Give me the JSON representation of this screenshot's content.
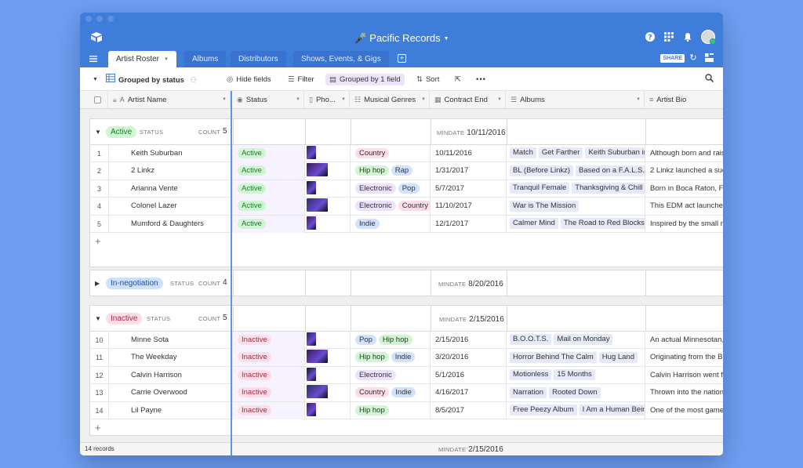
{
  "base": {
    "title": "Pacific Records"
  },
  "tabs": [
    {
      "label": "Artist Roster",
      "active": true
    },
    {
      "label": "Albums",
      "active": false
    },
    {
      "label": "Distributors",
      "active": false
    },
    {
      "label": "Shows, Events, & Gigs",
      "active": false
    }
  ],
  "tabbar": {
    "share_label": "SHARE"
  },
  "viewbar": {
    "view_name": "Grouped by status",
    "hide_fields": "Hide fields",
    "filter": "Filter",
    "grouped": "Grouped by 1 field",
    "sort": "Sort"
  },
  "columns": {
    "artist_name": "Artist Name",
    "status": "Status",
    "photo": "Pho...",
    "genres": "Musical Genres",
    "contract_end": "Contract End",
    "albums": "Albums",
    "bio": "Artist Bio"
  },
  "group_labels": {
    "status": "STATUS",
    "count": "COUNT",
    "mindate": "MINDATE"
  },
  "colors": {
    "active_bg": "#cff5d1",
    "active_text": "#1e7a2d",
    "negotiation_bg": "#cfe0fc",
    "negotiation_text": "#1d4e9c",
    "inactive_bg": "#fddde6",
    "inactive_text": "#a8294e",
    "country": "#fddde6",
    "hiphop": "#cff5d1",
    "rap": "#d1e2ff",
    "electronic": "#ede2fe",
    "pop": "#d1e2ff",
    "indie": "#d1e2ff"
  },
  "groups": [
    {
      "name": "Active",
      "count": "5",
      "mindate": "10/11/2016",
      "collapsed": false,
      "rows": [
        {
          "num": "1",
          "name": "Keith Suburban",
          "status": "Active",
          "genres": [
            "Country"
          ],
          "contract_end": "10/11/2016",
          "albums": [
            "Match",
            "Get Farther",
            "Keith Suburban in"
          ],
          "bio": "Although born and raised"
        },
        {
          "num": "2",
          "name": "2 Linkz",
          "status": "Active",
          "genres": [
            "Hip hop",
            "Rap"
          ],
          "contract_end": "1/31/2017",
          "albums": [
            "BL (Before Linkz)",
            "Based on a F.A.L.S.E"
          ],
          "bio": "2 Linkz launched a succ"
        },
        {
          "num": "3",
          "name": "Arianna Vente",
          "status": "Active",
          "genres": [
            "Electronic",
            "Pop"
          ],
          "contract_end": "5/7/2017",
          "albums": [
            "Tranquil Female",
            "Thanksgiving & Chill"
          ],
          "bio": "Born in Boca Raton, Fl"
        },
        {
          "num": "4",
          "name": "Colonel Lazer",
          "status": "Active",
          "genres": [
            "Electronic",
            "Country"
          ],
          "contract_end": "11/10/2017",
          "albums": [
            "War is The Mission"
          ],
          "bio": "This EDM act launched"
        },
        {
          "num": "5",
          "name": "Mumford & Daughters",
          "status": "Active",
          "genres": [
            "Indie"
          ],
          "contract_end": "12/1/2017",
          "albums": [
            "Calmer Mind",
            "The Road to Red Blocks"
          ],
          "bio": "Inspired by the small r"
        }
      ]
    },
    {
      "name": "In-negotiation",
      "count": "4",
      "mindate": "8/20/2016",
      "collapsed": true,
      "rows": []
    },
    {
      "name": "Inactive",
      "count": "5",
      "mindate": "2/15/2016",
      "collapsed": false,
      "rows": [
        {
          "num": "10",
          "name": "Minne Sota",
          "status": "Inactive",
          "genres": [
            "Pop",
            "Hip hop"
          ],
          "contract_end": "2/15/2016",
          "albums": [
            "B.O.O.T.S.",
            "Mail on Monday"
          ],
          "bio": "An actual Minnesotan,"
        },
        {
          "num": "11",
          "name": "The Weekday",
          "status": "Inactive",
          "genres": [
            "Hip hop",
            "Indie"
          ],
          "contract_end": "3/20/2016",
          "albums": [
            "Horror Behind The Calm",
            "Hug Land"
          ],
          "bio": "Originating from the B"
        },
        {
          "num": "12",
          "name": "Calvin Harrison",
          "status": "Inactive",
          "genres": [
            "Electronic"
          ],
          "contract_end": "5/1/2016",
          "albums": [
            "Motionless",
            "15 Months"
          ],
          "bio": "Calvin Harrison went f"
        },
        {
          "num": "13",
          "name": "Carrie Overwood",
          "status": "Inactive",
          "genres": [
            "Country",
            "Indie"
          ],
          "contract_end": "4/16/2017",
          "albums": [
            "Narration",
            "Rooted Down"
          ],
          "bio": "Thrown into the nation"
        },
        {
          "num": "14",
          "name": "Lil Payne",
          "status": "Inactive",
          "genres": [
            "Hip hop"
          ],
          "contract_end": "8/5/2017",
          "albums": [
            "Free Peezy Album",
            "I Am a Human Being"
          ],
          "bio": "One of the most game"
        }
      ]
    }
  ],
  "footer": {
    "records": "14 records",
    "mindate": "2/15/2016"
  }
}
